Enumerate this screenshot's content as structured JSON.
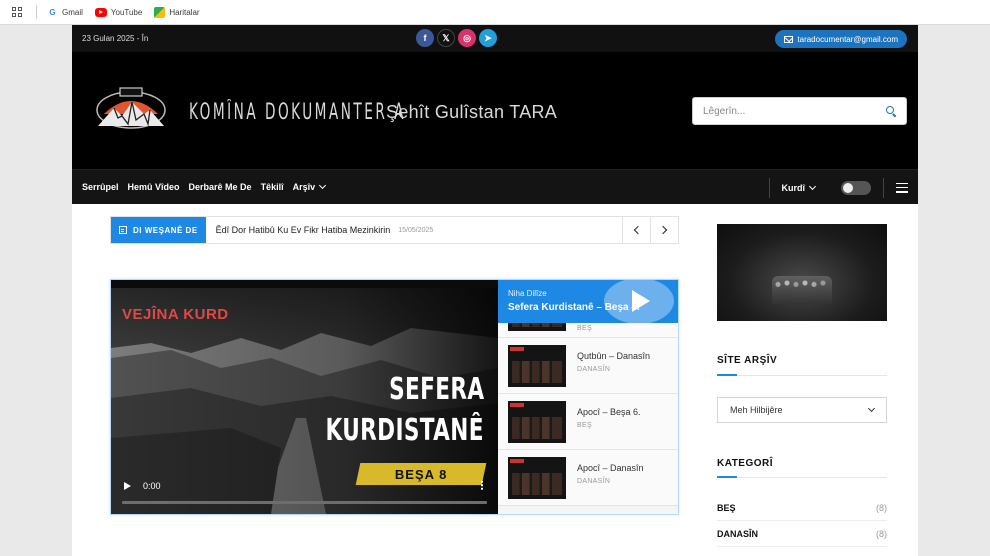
{
  "browser": {
    "bookmarks": [
      {
        "label": "Gmail",
        "icon": "google-icon"
      },
      {
        "label": "YouTube",
        "icon": "youtube-icon"
      },
      {
        "label": "Haritalar",
        "icon": "maps-icon"
      }
    ]
  },
  "topbar": {
    "date": "23 Gulan 2025 - În",
    "email": "taradocumentar@gmail.com",
    "socials": [
      "facebook-icon",
      "x-icon",
      "instagram-icon",
      "telegram-icon"
    ]
  },
  "masthead": {
    "brand": "KOMÎNA DOKUMANTER A",
    "brand_sub": "Şehît Gulîstan TARA",
    "search_placeholder": "Lêgerîn..."
  },
  "nav": {
    "items": [
      "Serrûpel",
      "Hemû Vîdeo",
      "Derbarê Me De",
      "Têkilî",
      "Arşîv"
    ],
    "language": "Kurdî"
  },
  "ticker": {
    "label": "DI WEŞANÊ DE",
    "headline": "Êdî Dor Hatibû Ku Ev Fikr Hatiba Mezinkirin",
    "date": "15/05/2025"
  },
  "video": {
    "overlay_red": "VEJÎNA KURD",
    "overlay_line1": "SEFERA",
    "overlay_line2": "KURDISTANÊ",
    "badge": "BEŞA 8",
    "time": "0:00"
  },
  "playlist": {
    "kicker": "Niha Dilîze",
    "current": "Sefera Kurdistanê – Beşa 8.",
    "items": [
      {
        "title": "",
        "category": "BEŞ"
      },
      {
        "title": "Qutbûn – Danasîn",
        "category": "DANASÎN"
      },
      {
        "title": "Apocî – Beşa 6.",
        "category": "BEŞ"
      },
      {
        "title": "Apocî – Danasîn",
        "category": "DANASÎN"
      }
    ]
  },
  "sidebar": {
    "archive_heading": "SÎTE ARŞÎV",
    "archive_select": "Meh Hilbijêre",
    "category_heading": "KATEGORÎ",
    "categories": [
      {
        "name": "BEŞ",
        "count": "(8)"
      },
      {
        "name": "DANASÎN",
        "count": "(8)"
      }
    ]
  }
}
